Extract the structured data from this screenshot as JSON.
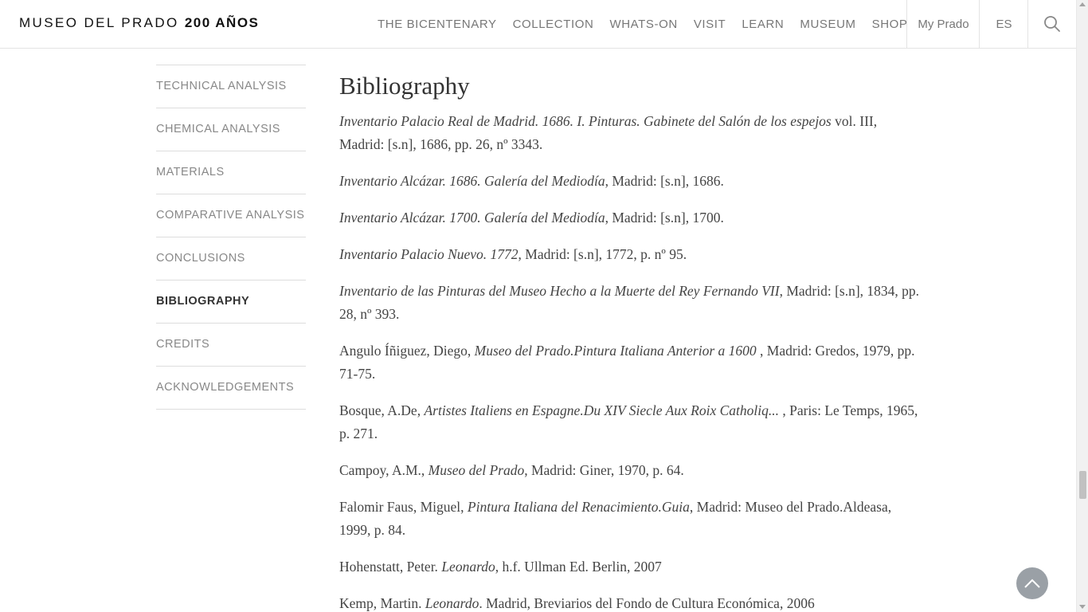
{
  "header": {
    "logo_text": "MUSEO DEL PRADO",
    "logo_bold": "200 AÑOS",
    "nav": [
      "THE BICENTENARY",
      "COLLECTION",
      "WHATS-ON",
      "VISIT",
      "LEARN",
      "MUSEUM",
      "SHOP"
    ],
    "my_prado": "My Prado",
    "lang": "ES",
    "search_icon": "search-icon"
  },
  "sidebar": {
    "items": [
      {
        "label": "TECHNICAL ANALYSIS",
        "active": false
      },
      {
        "label": "CHEMICAL ANALYSIS",
        "active": false
      },
      {
        "label": "MATERIALS",
        "active": false
      },
      {
        "label": "COMPARATIVE ANALYSIS",
        "active": false
      },
      {
        "label": "CONCLUSIONS",
        "active": false
      },
      {
        "label": "BIBLIOGRAPHY",
        "active": true
      },
      {
        "label": "CREDITS",
        "active": false
      },
      {
        "label": "ACKNOWLEDGEMENTS",
        "active": false
      }
    ]
  },
  "main": {
    "title": "Bibliography",
    "entries": [
      {
        "pre": "",
        "ital": "Inventario Palacio Real de Madrid. 1686. I. Pinturas. Gabinete del Salón de los espejos",
        "post": " vol. III, Madrid: [s.n], 1686, pp. 26, nº 3343."
      },
      {
        "pre": "",
        "ital": "Inventario Alcázar. 1686. Galería del Mediodía",
        "post": ", Madrid: [s.n], 1686."
      },
      {
        "pre": "",
        "ital": "Inventario Alcázar. 1700. Galería del Mediodía",
        "post": ", Madrid: [s.n], 1700."
      },
      {
        "pre": "",
        "ital": "Inventario Palacio Nuevo. 1772",
        "post": ", Madrid: [s.n], 1772, p. nº 95."
      },
      {
        "pre": "",
        "ital": "Inventario de las Pinturas del Museo Hecho a la Muerte del Rey Fernando VII",
        "post": ", Madrid: [s.n], 1834, pp. 28, nº 393."
      },
      {
        "pre": "Angulo Íñiguez, Diego, ",
        "ital": "Museo del Prado.Pintura Italiana Anterior a 1600",
        "post": " , Madrid: Gredos, 1979, pp. 71-75."
      },
      {
        "pre": "Bosque, A.De, ",
        "ital": "Artistes Italiens en Espagne.Du XIV Siecle Aux Roix Catholiq...",
        "post": " , Paris: Le Temps, 1965, p. 271."
      },
      {
        "pre": "Campoy, A.M., ",
        "ital": "Museo del Prado",
        "post": ", Madrid: Giner, 1970, p. 64."
      },
      {
        "pre": "Falomir Faus, Miguel, ",
        "ital": "Pintura Italiana del Renacimiento.Guia",
        "post": ", Madrid: Museo del Prado.Aldeasa, 1999, p. 84."
      },
      {
        "pre": "Hohenstatt, Peter. ",
        "ital": "Leonardo",
        "post": ", h.f. Ullman Ed. Berlin, 2007"
      },
      {
        "pre": "Kemp, Martin. ",
        "ital": "Leonardo",
        "post": ". Madrid, Breviarios del Fondo de Cultura Económica, 2006"
      }
    ]
  },
  "back_to_top_icon": "chevron-up-icon",
  "colors": {
    "accent": "#333333",
    "muted": "#777777",
    "to_top_bg": "#9aa0a6"
  }
}
